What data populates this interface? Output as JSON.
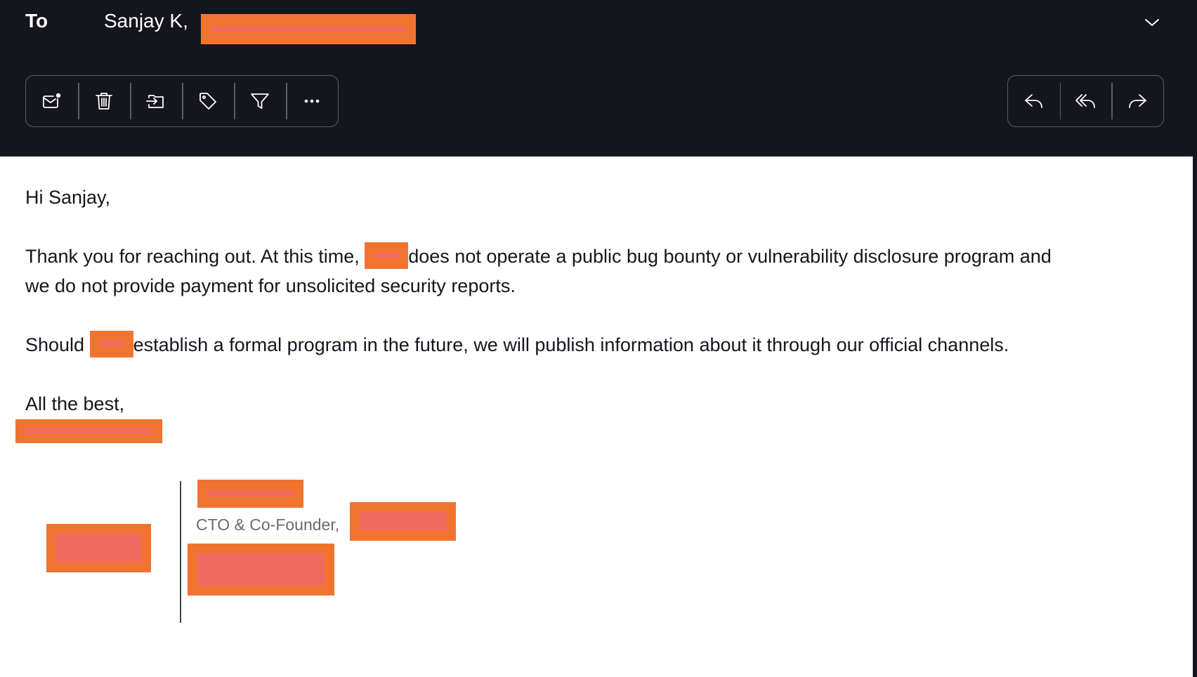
{
  "header": {
    "to_label": "To",
    "recipient": "Sanjay K,",
    "recipient_email_redacted": ""
  },
  "toolbar": {
    "left": [
      {
        "name": "mark-unread",
        "icon": "envelope-dot-icon"
      },
      {
        "name": "delete",
        "icon": "trash-icon"
      },
      {
        "name": "move",
        "icon": "move-to-folder-icon"
      },
      {
        "name": "tag",
        "icon": "tag-icon"
      },
      {
        "name": "filter",
        "icon": "filter-icon"
      },
      {
        "name": "more",
        "icon": "more-horizontal-icon"
      }
    ],
    "right": [
      {
        "name": "reply",
        "icon": "reply-icon"
      },
      {
        "name": "reply-all",
        "icon": "reply-all-icon"
      },
      {
        "name": "forward",
        "icon": "forward-icon"
      }
    ]
  },
  "message": {
    "greeting": "Hi Sanjay,",
    "p1_before": "Thank you for reaching out. At this time, ",
    "p1_after": "does not operate a public bug bounty or vulnerability disclosure program and",
    "p1_line2": "we do not provide payment for unsolicited security reports.",
    "p2_before": "Should ",
    "p2_after": "establish a formal program in the future, we will publish information about it through our official channels.",
    "closing": "All the best,"
  },
  "signature": {
    "title": "CTO & Co-Founder,"
  },
  "colors": {
    "header_bg": "#15151e",
    "redaction": "#f07430",
    "redaction_inner": "#ee6a5e",
    "text": "#15151e"
  }
}
